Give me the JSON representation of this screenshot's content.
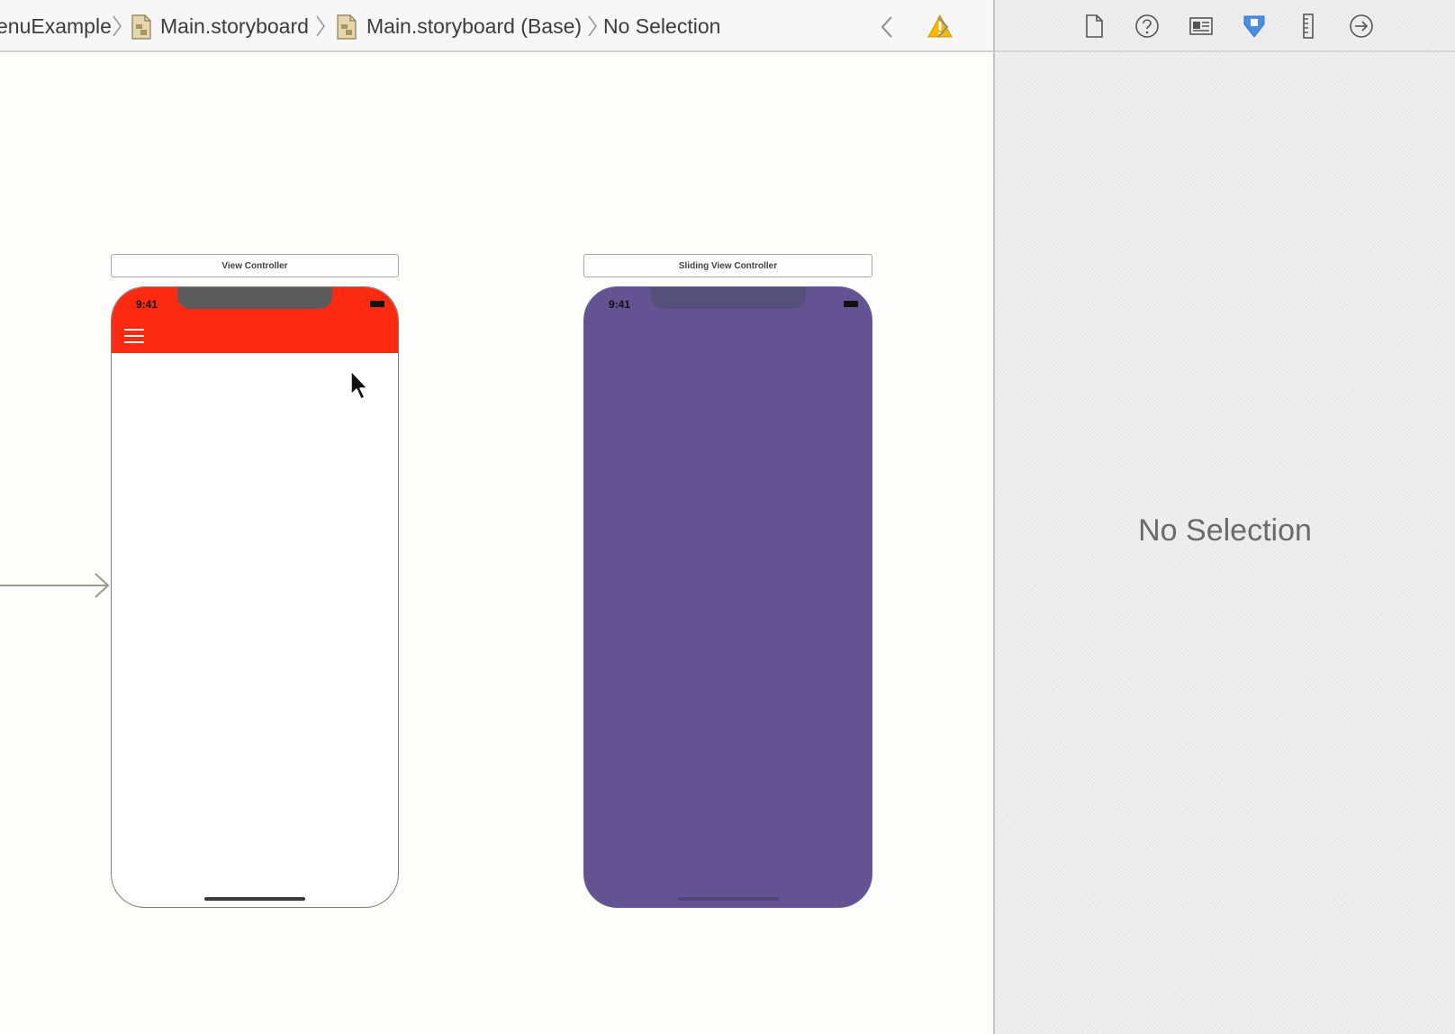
{
  "jumpbar": {
    "crumbs": [
      {
        "label": "enuExample"
      },
      {
        "label": "Main.storyboard"
      },
      {
        "label": "Main.storyboard (Base)"
      },
      {
        "label": "No Selection"
      }
    ],
    "icons": {
      "back": "chevron-left-icon",
      "issue": "warning-icon",
      "forward": "chevron-right-icon",
      "file": "storyboard-file-icon"
    },
    "warning_color": "#f5b800"
  },
  "canvas": {
    "scenes": [
      {
        "title": "View Controller",
        "time": "9:41",
        "navbar_color": "#fd2a12",
        "background": "#ffffff"
      },
      {
        "title": "Sliding View Controller",
        "time": "9:41",
        "background": "#635393"
      }
    ],
    "icons": {
      "menu": "hamburger-menu-icon",
      "entry": "initial-controller-arrow-icon",
      "cursor": "mouse-cursor-icon"
    }
  },
  "inspector": {
    "tabs": [
      {
        "icon": "file-inspector-icon",
        "active": false
      },
      {
        "icon": "quick-help-icon",
        "active": false
      },
      {
        "icon": "identity-inspector-icon",
        "active": false
      },
      {
        "icon": "attributes-inspector-icon",
        "active": true
      },
      {
        "icon": "size-inspector-icon",
        "active": false
      },
      {
        "icon": "connections-inspector-icon",
        "active": false
      }
    ],
    "active_color": "#4a90e2",
    "empty_label": "No Selection"
  }
}
